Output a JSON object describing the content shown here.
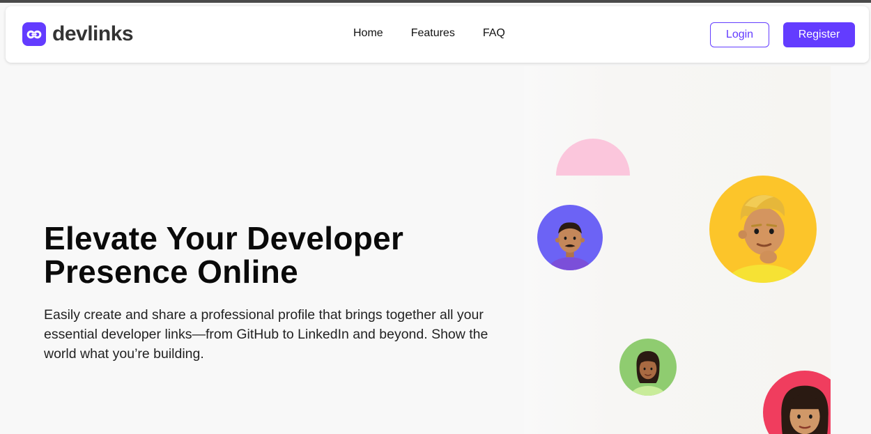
{
  "brand": {
    "name": "devlinks",
    "accent_color": "#633cff",
    "logo_icon": "link-chain-icon"
  },
  "nav": {
    "links": [
      "Home",
      "Features",
      "FAQ"
    ],
    "login_label": "Login",
    "register_label": "Register"
  },
  "hero": {
    "title": "Elevate Your Developer Presence Online",
    "description": "Easily create and share a professional profile that brings together all your essential developer links—from GitHub to LinkedIn and beyond. Show the world what you’re building."
  },
  "illustration": {
    "avatars": [
      {
        "icon": "avatar-man-mustache-icon",
        "background": "#6c63f5"
      },
      {
        "icon": "avatar-blond-man-icon",
        "background": "#fcc52a"
      },
      {
        "icon": "avatar-woman-icon",
        "background": "#8fcc70"
      },
      {
        "icon": "avatar-woman-bangs-icon",
        "background": "#f03d5e"
      }
    ],
    "shape_color": "#fbc6dc"
  }
}
